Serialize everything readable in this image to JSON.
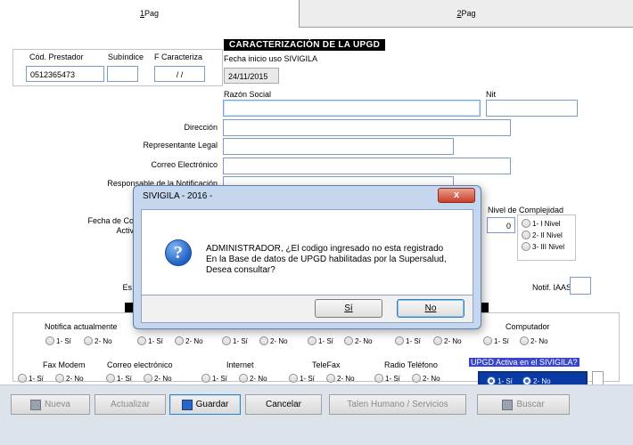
{
  "tabs": [
    {
      "label": "1Pag",
      "accel": "1",
      "rest": "Pag"
    },
    {
      "label": "2Pag",
      "accel": "2",
      "rest": "Pag"
    }
  ],
  "section_title": "CARACTERIZACIÓN DE LA UPGD",
  "fields": {
    "cod_prestador": {
      "label": "Cód. Prestador",
      "value": "0512365473"
    },
    "subindice": {
      "label": "Subíndice",
      "value": ""
    },
    "f_caracteriza": {
      "label": "F Caracteriza",
      "value": "/ /"
    },
    "fecha_inicio": {
      "label": "Fecha inicio uso SIVIGILA",
      "value": "24/11/2015"
    },
    "razon_social": {
      "label": "Razón Social",
      "value": ""
    },
    "nit": {
      "label": "Nit",
      "value": ""
    },
    "direccion": {
      "label": "Dirección",
      "value": ""
    },
    "representante": {
      "label": "Representante Legal",
      "value": ""
    },
    "correo": {
      "label": "Correo Electrónico",
      "value": ""
    },
    "responsable": {
      "label": "Responsable de la Notificación",
      "value": ""
    },
    "fecha_co_partial": {
      "label": "Fecha de Co",
      "label2": "Activ"
    },
    "es_partial": {
      "label": "Es"
    },
    "notif_iaas": {
      "label": "Notif. IAAS",
      "value": ""
    }
  },
  "complejidad": {
    "label": "Nivel de Complejidad",
    "value": "0",
    "options": [
      "1- I  Nivel",
      "2- II Nivel",
      "3- III Nivel"
    ]
  },
  "group_row1": {
    "labels": [
      "Notifica actualmente",
      "Computador"
    ],
    "radios": [
      "1- Sí",
      "2- No"
    ]
  },
  "group_row2": {
    "labels": [
      "Fax Modem",
      "Correo electrónico",
      "Internet",
      "TeleFax",
      "Radio Teléfono"
    ],
    "radios": [
      "1- Sí",
      "2- No"
    ]
  },
  "upgd_activa": {
    "label": "UPGD Activa en el SIVIGILA?",
    "options": [
      "1- Sí",
      "2- No"
    ]
  },
  "buttons": {
    "nueva": "Nueva",
    "actualizar": "Actualizar",
    "guardar": "Guardar",
    "cancelar": "Cancelar",
    "talento": "Talen Humano / Servicios",
    "buscar": "Buscar"
  },
  "dialog": {
    "title": "SIVIGILA - 2016 -",
    "close": "x",
    "message_lines": [
      "ADMINISTRADOR, ¿El codigo ingresado no esta registrado",
      "En la Base de datos de UPGD habilitadas por la Supersalud,",
      "Desea consultar?"
    ],
    "yes": "Sí",
    "no": "No"
  },
  "colors": {
    "accent": "#0a3ba5",
    "dialog_frame": "#c5d7ee",
    "close_button": "#c7402c"
  }
}
